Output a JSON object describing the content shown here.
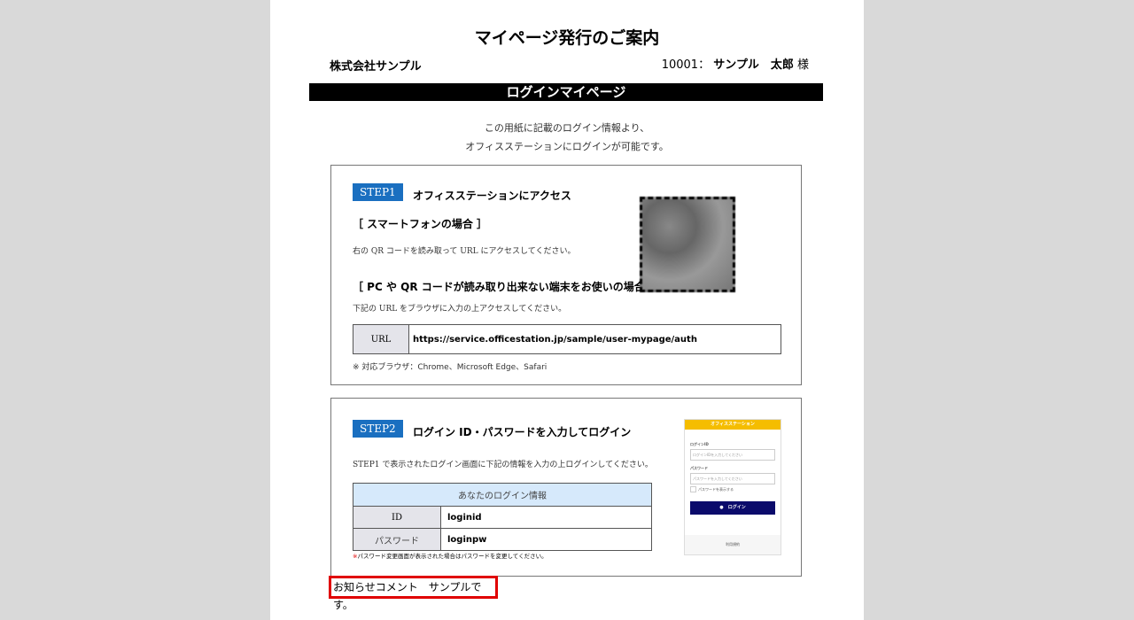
{
  "document": {
    "title": "マイページ発行のご案内",
    "company": "株式会社サンプル",
    "recipient": {
      "id": "10001：",
      "name": "サンプル　太郎",
      "honorific": "様"
    },
    "banner": "ログインマイページ",
    "intro": [
      "この用紙に記載のログイン情報より、",
      "オフィスステーションにログインが可能です。"
    ]
  },
  "step1": {
    "badge": "STEP1",
    "title": "オフィスステーションにアクセス",
    "smartphone_heading": "［ スマートフォンの場合 ］",
    "smartphone_text": "右の QR コードを読み取って URL にアクセスしてください。",
    "pc_heading": "［ PC や QR コードが読み取り出来ない端末をお使いの場合 ］",
    "pc_text": "下記の URL をブラウザに入力の上アクセスしてください。",
    "url_label": "URL",
    "url": "https://service.officestation.jp/sample/user-mypage/auth",
    "browsers": "※ 対応ブラウザ：Chrome、Microsoft Edge、Safari"
  },
  "step2": {
    "badge": "STEP2",
    "title": "ログイン ID・パスワードを入力してログイン",
    "instruction": "STEP1 で表示されたログイン画面に下記の情報を入力の上ログインしてください。",
    "table_header": "あなたのログイン情報",
    "rows": [
      {
        "label": "ID",
        "value": "loginid"
      },
      {
        "label": "パスワード",
        "value": "loginpw"
      }
    ],
    "note_mark": "※",
    "note": "パスワード変更画面が表示された場合はパスワードを変更してください。",
    "mockup": {
      "app_name": "オフィスステーション",
      "id_label": "ログインID",
      "id_placeholder": "ログインIDを入力してください",
      "pw_label": "パスワード",
      "pw_placeholder": "パスワードを入力してください",
      "show_pw": "パスワードを表示する",
      "login_button": "ログイン",
      "footer": "利用規約"
    }
  },
  "notice": "お知らせコメント　サンプルです。",
  "colors": {
    "step_badge": "#1a6fc0",
    "table_header": "#d6e9fb",
    "notice_border": "#e00000",
    "mock_header": "#f5bd00",
    "mock_button": "#0b0b6b"
  }
}
